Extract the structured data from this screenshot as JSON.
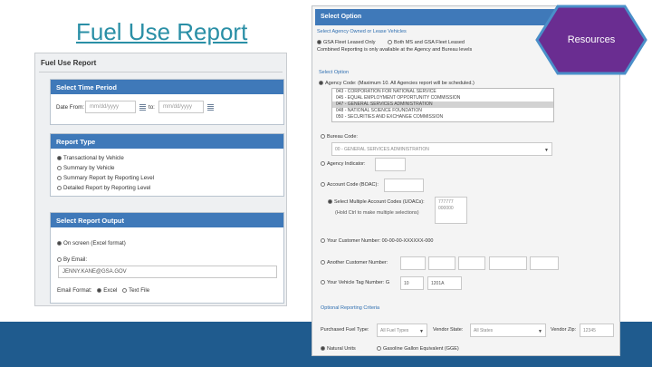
{
  "slide": {
    "title": "Fuel Use Report"
  },
  "left_panel": {
    "title": "Fuel Use Report",
    "time_period": {
      "header": "Select Time Period",
      "date_from_label": "Date From:",
      "date_from_placeholder": "mm/dd/yyyy",
      "to_label": "to:",
      "to_placeholder": "mm/dd/yyyy"
    },
    "report_type": {
      "header": "Report Type",
      "options": [
        "Transactional by Vehicle",
        "Summary by Vehicle",
        "Summary Report by Reporting Level",
        "Detailed Report by Reporting Level"
      ]
    },
    "output": {
      "header": "Select Report Output",
      "on_screen": "On screen (Excel format)",
      "by_email": "By Email:",
      "email_value": "JENNY.KANE@GSA.GOV",
      "email_format_label": "Email Format:",
      "format_excel": "Excel",
      "format_text": "Text File"
    }
  },
  "right_panel": {
    "header": "Select Option",
    "agency_section": "Select Agency Owned or Lease Vehicles",
    "gsa_only": "GSA Fleet Leased Only",
    "both": "Both MS and GSA Fleet Leased",
    "combined_note": "Combined Reporting is only available at the Agency and Bureau levels",
    "select_option": "Select Option",
    "agency_code_label": "Agency Code: (Maximum 10. All Agencies report will be scheduled.)",
    "agency_list": [
      "043 - CORPORATION FOR NATIONAL SERVICE",
      "045 - EQUAL EMPLOYMENT OPPORTUNITY COMMISSION",
      "047 - GENERAL SERVICES ADMINISTRATION",
      "048 - NATIONAL SCIENCE FOUNDATION",
      "050 - SECURITIES AND EXCHANGE COMMISSION"
    ],
    "bureau_label": "Bureau Code:",
    "bureau_value": "00 - GENERAL SERVICES ADMINISTRATION",
    "agency_indicator": "Agency Indicator:",
    "account_code": "Account Code (BOAC):",
    "multiple_codes": "Select Multiple Account Codes (UOACs):",
    "multiple_values": [
      "777777",
      "000000"
    ],
    "ctrl_note": "(Hold Ctrl to make multiple selections)",
    "customer_number": "Your Customer Number: 00-00-00-XXXXXX-000",
    "another_customer": "Another Customer Number:",
    "tag_label": "Your Vehicle Tag Number: G",
    "tag_value_1": "10",
    "tag_value_2": "1201A",
    "optional": "Optional Reporting Criteria",
    "fuel_type_label": "Purchased Fuel Type:",
    "fuel_type_value": "All Fuel Types",
    "vendor_state_label": "Vendor State:",
    "vendor_state_value": "All States",
    "vendor_zip_label": "Vendor Zip:",
    "vendor_zip_value": "12345",
    "natural_units": "Natural Units",
    "gge": "Gasoline Gallon Equivalent (GGE)"
  },
  "resources": {
    "label": "Resources"
  },
  "colors": {
    "accent": "#2a8fa6",
    "band": "#1f5b8e",
    "card_header": "#3f79b9",
    "hex_fill": "#6a2d91",
    "hex_border": "#4a8fc9"
  }
}
